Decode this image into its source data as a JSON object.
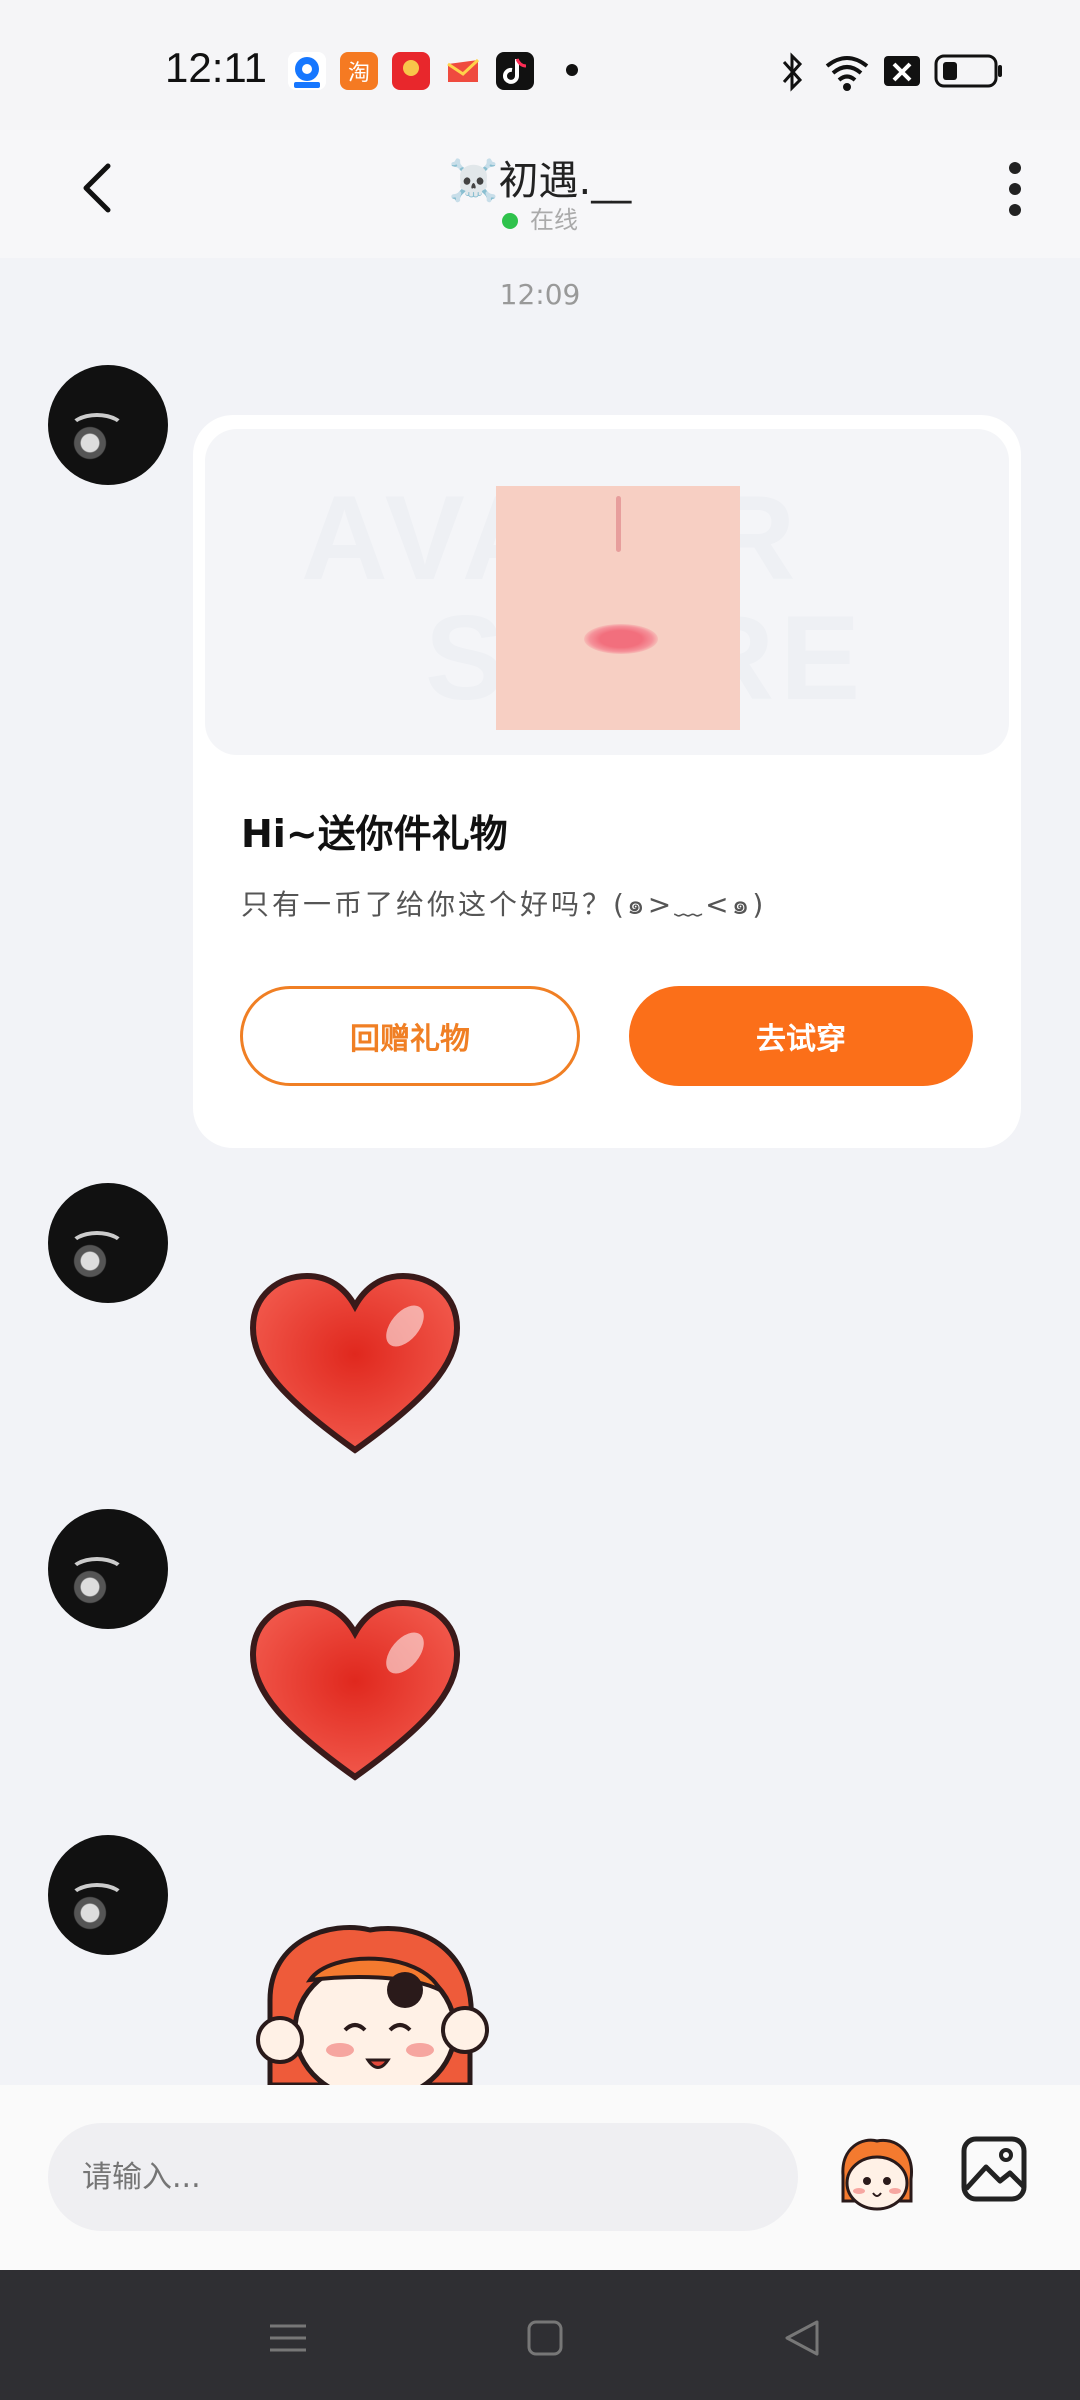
{
  "status_bar": {
    "time": "12:11",
    "app_icons": [
      "淘"
    ]
  },
  "header": {
    "title": "☠️初遇.__",
    "status": "在线"
  },
  "chat": {
    "timestamp": "12:09",
    "gift_card": {
      "title": "Hi~送你件礼物",
      "subtitle": "只有一币了给你这个好吗？(๑>﹏<๑)",
      "return_gift_label": "回赠礼物",
      "try_on_label": "去试穿"
    }
  },
  "input_bar": {
    "placeholder": "请输入..."
  },
  "colors": {
    "accent": "#fb6f19",
    "online": "#2fc24c",
    "background": "#f2f3f7"
  }
}
